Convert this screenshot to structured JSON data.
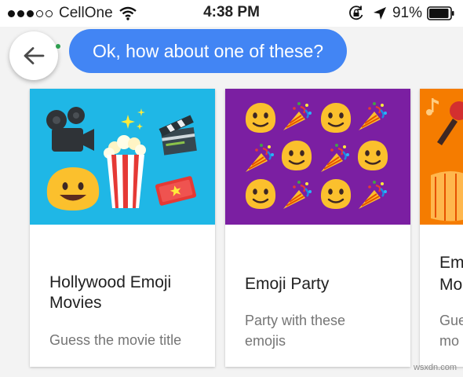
{
  "status_bar": {
    "carrier": "CellOne",
    "time": "4:38 PM",
    "battery": "91%"
  },
  "chat": {
    "message": "Ok, how about one of these?"
  },
  "cards": [
    {
      "title_line1": "Hollywood Emoji",
      "title_line2": "Movies",
      "subtitle_line1": "Guess the movie title",
      "subtitle_line2": "",
      "image_bg": "#1fb7e6"
    },
    {
      "title_line1": "Emoji Party",
      "title_line2": "",
      "subtitle_line1": "Party with these",
      "subtitle_line2": "emojis",
      "image_bg": "#7b1fa2"
    },
    {
      "title_line1": "Em",
      "title_line2": "Mo",
      "subtitle_line1": "Gue",
      "subtitle_line2": "mo",
      "image_bg": "#f57c00"
    }
  ],
  "watermark": "wsxdn.com",
  "colors": {
    "accent": "#4285f4",
    "online": "#2e9e4f"
  },
  "icons": [
    "signal-dots",
    "wifi-icon",
    "rotation-lock-icon",
    "location-arrow-icon",
    "battery-icon",
    "back-arrow-icon"
  ]
}
